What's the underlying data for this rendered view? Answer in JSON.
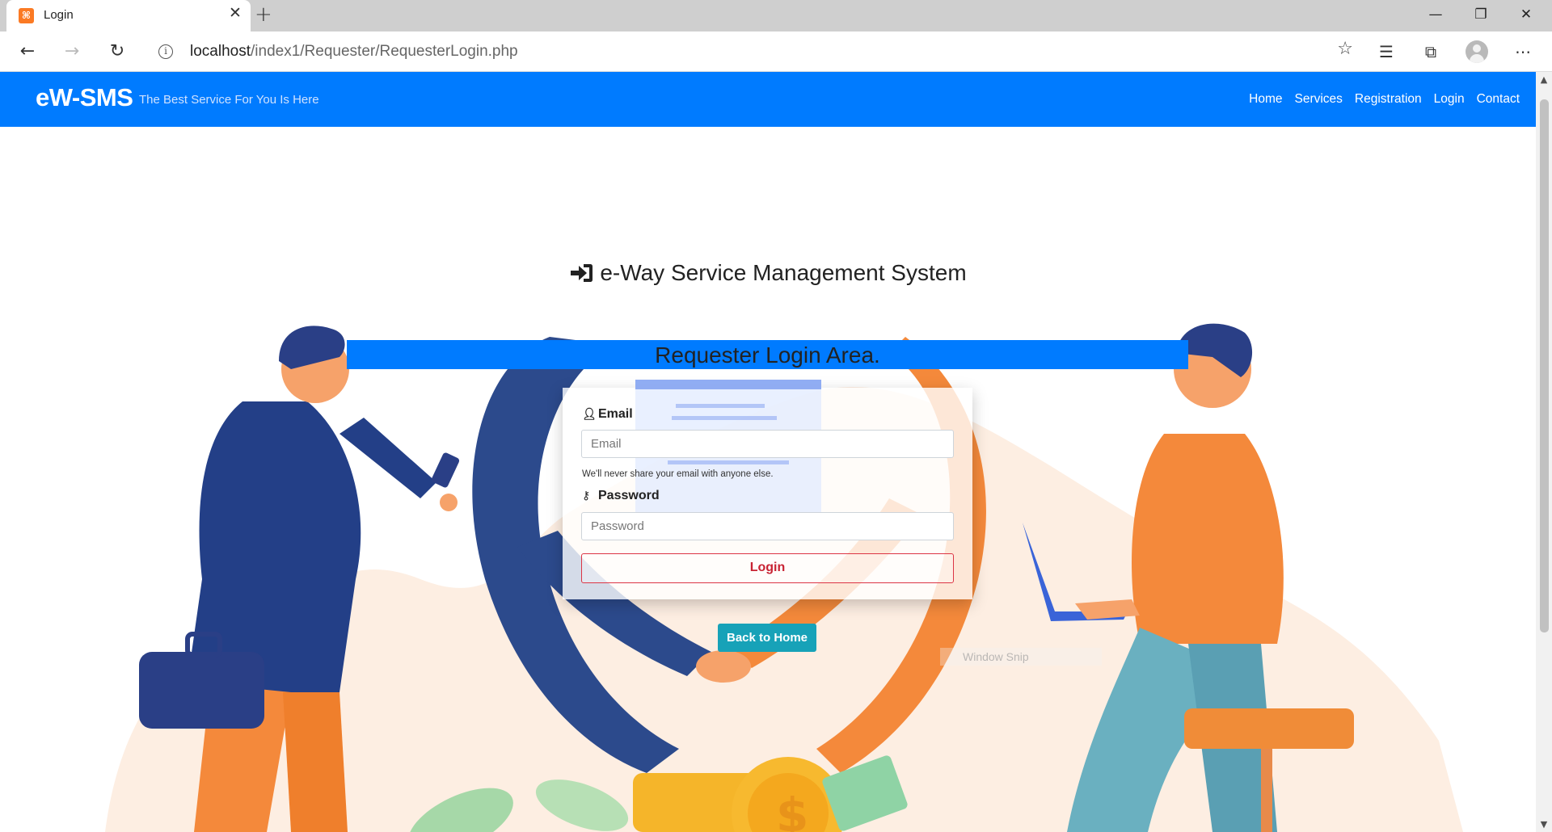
{
  "browser": {
    "tab_title": "Login",
    "tab_favicon": "xampp-icon",
    "url_host": "localhost",
    "url_path": "/index1/Requester/RequesterLogin.php",
    "window_controls": [
      "minimize",
      "restore",
      "close"
    ]
  },
  "navbar": {
    "brand": "eW-SMS",
    "tagline": "The Best Service For You Is Here",
    "links": [
      "Home",
      "Services",
      "Registration",
      "Login",
      "Contact"
    ],
    "color": "#007bff"
  },
  "main": {
    "heading": "e-Way Service Management System",
    "banner": "Requester Login Area.",
    "form": {
      "email_label": "Email",
      "email_placeholder": "Email",
      "email_help": "We'll never share your email with anyone else.",
      "password_label": "Password",
      "password_placeholder": "Password",
      "login_button": "Login"
    },
    "back_button": "Back to Home"
  },
  "overlay": {
    "snip_text": "Window Snip"
  },
  "colors": {
    "primary": "#007bff",
    "danger": "#dc3545",
    "info": "#17a2b8"
  }
}
